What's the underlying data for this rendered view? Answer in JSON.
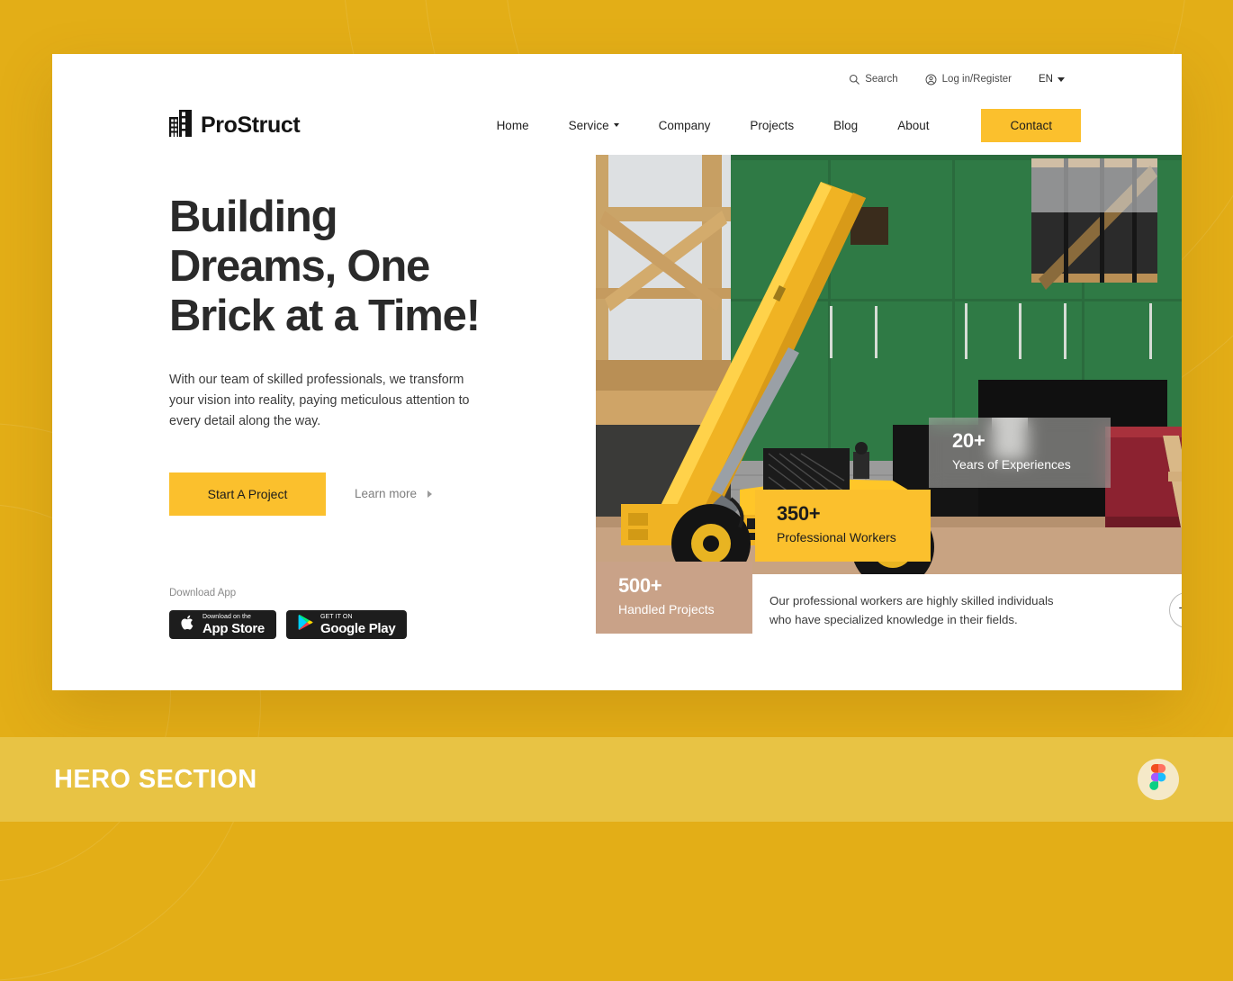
{
  "brand": {
    "name": "ProStruct",
    "logo_icon": "building-icon"
  },
  "topbar": {
    "search_label": "Search",
    "search_icon": "search-icon",
    "account_label": "Log in/Register",
    "account_icon": "user-circle-icon",
    "language": "EN",
    "language_caret_icon": "chevron-down-icon"
  },
  "nav": {
    "items": [
      {
        "label": "Home",
        "has_dropdown": false
      },
      {
        "label": "Service",
        "has_dropdown": true
      },
      {
        "label": "Company",
        "has_dropdown": false
      },
      {
        "label": "Projects",
        "has_dropdown": false
      },
      {
        "label": "Blog",
        "has_dropdown": false
      },
      {
        "label": "About",
        "has_dropdown": false
      }
    ],
    "cta_label": "Contact"
  },
  "hero": {
    "headline_line1": "Building",
    "headline_line2": "Dreams, One",
    "headline_line3": "Brick at a Time!",
    "subtext": "With our team of skilled professionals, we transform your vision into reality, paying meticulous attention to every detail along the way.",
    "primary_cta": "Start A Project",
    "secondary_cta": "Learn more",
    "secondary_cta_icon": "chevron-right-icon",
    "download_label": "Download App",
    "badges": [
      {
        "icon": "apple-icon",
        "small": "Download on the",
        "big": "App Store"
      },
      {
        "icon": "google-play-icon",
        "small": "GET IT ON",
        "big": "Google Play"
      }
    ],
    "image_alt": "construction-site-telehandler-photo",
    "stats": [
      {
        "value": "20+",
        "label": "Years of Experiences",
        "style": "glass"
      },
      {
        "value": "350+",
        "label": "Professional Workers",
        "style": "yellow"
      },
      {
        "value": "500+",
        "label": "Handled Projects",
        "style": "tan"
      }
    ],
    "caption": "Our professional workers are highly skilled individuals who have specialized knowledge in their fields.",
    "caption_arrow_icon": "arrow-right-icon"
  },
  "banner": {
    "title": "HERO SECTION",
    "logo_icon": "figma-icon"
  },
  "colors": {
    "page_background": "#E3AE17",
    "banner_background": "#E8C344",
    "accent_yellow": "#FBC02D",
    "tan_card": "#C9A288",
    "card_background": "#FFFFFF",
    "heading_text": "#2A2A2A"
  }
}
